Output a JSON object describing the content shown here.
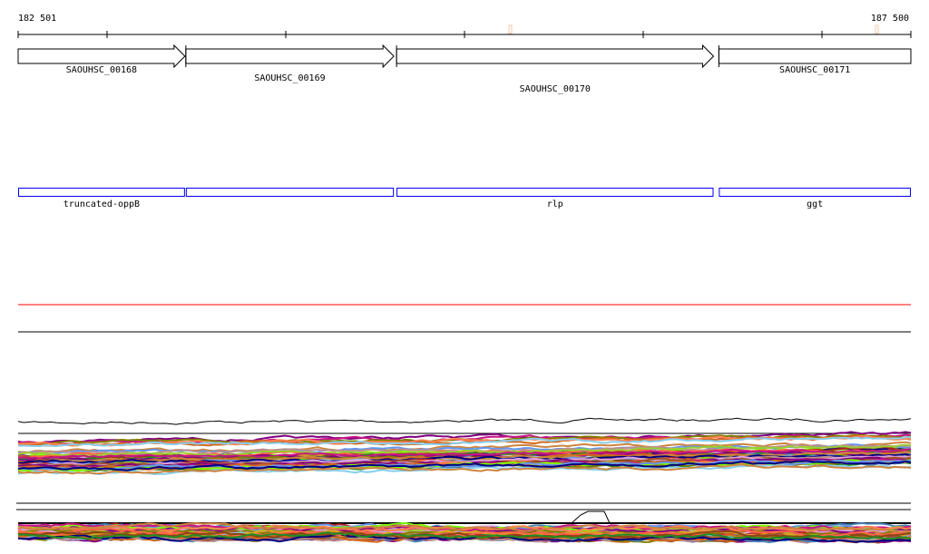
{
  "ruler": {
    "start_label": "182 501",
    "end_label": "187 500",
    "start": 182501,
    "end": 187500
  },
  "genes": [
    {
      "name": "SAOUHSC_00168",
      "start": 182501,
      "end": 183435,
      "strand": "+"
    },
    {
      "name": "SAOUHSC_00169",
      "start": 183440,
      "end": 184605,
      "strand": "+"
    },
    {
      "name": "SAOUHSC_00170",
      "start": 184620,
      "end": 186395,
      "strand": "+"
    },
    {
      "name": "SAOUHSC_00171",
      "start": 186425,
      "end": 187500,
      "strand": "none"
    }
  ],
  "features": [
    {
      "name": "truncated-oppB",
      "start": 182501,
      "end": 183435
    },
    {
      "name": "",
      "start": 183440,
      "end": 184605
    },
    {
      "name": "rlp",
      "start": 184620,
      "end": 186395
    },
    {
      "name": "ggt",
      "start": 186425,
      "end": 187500
    }
  ],
  "markers": [
    185255,
    187305
  ],
  "colors": {
    "gene": "#000000",
    "feature": "#0000ff",
    "marker": "#f5c6a8",
    "red_track": "#ff0000",
    "trace_palette": [
      "#800080",
      "#c71585",
      "#808000",
      "#d2691e",
      "#ff7f50",
      "#87ceeb",
      "#7cfc00",
      "#cd853f",
      "#6495ed",
      "#000080",
      "#b22222",
      "#bc8f8f",
      "#ff6347",
      "#9acd32",
      "#daa520",
      "#8b4513",
      "#dda0dd",
      "#a0522d",
      "#228b22",
      "#4682b4"
    ]
  }
}
